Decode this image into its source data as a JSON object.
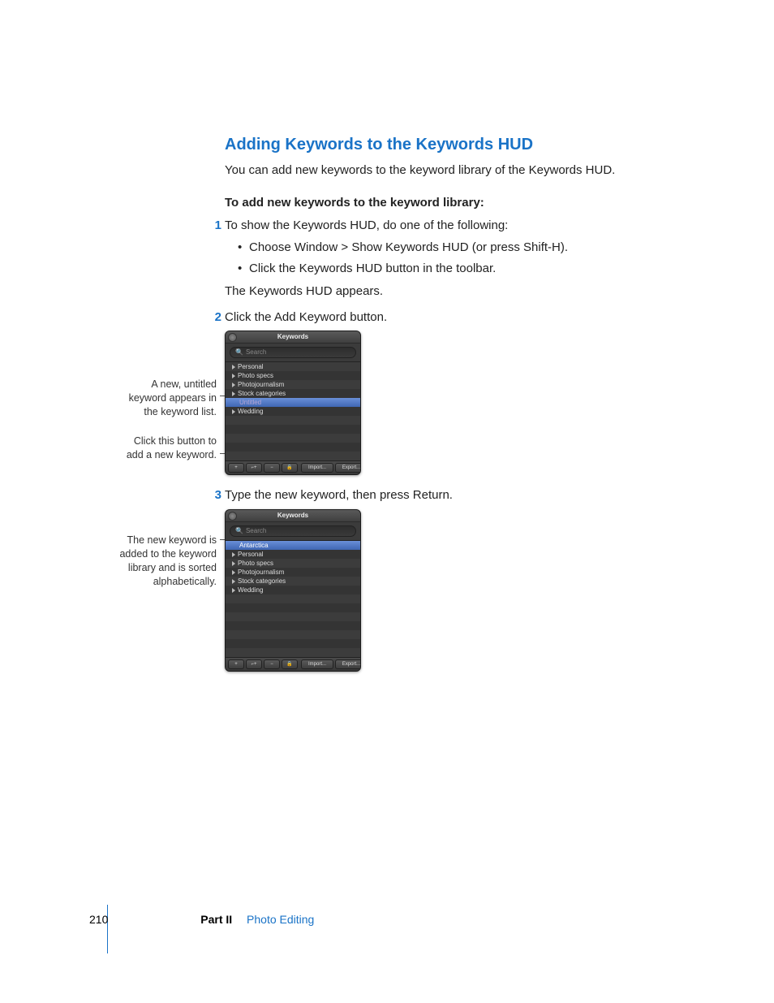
{
  "heading": "Adding Keywords to the Keywords HUD",
  "intro": "You can add new keywords to the keyword library of the Keywords HUD.",
  "task_heading": "To add new keywords to the keyword library:",
  "steps": {
    "n1": "1",
    "s1": "To show the Keywords HUD, do one of the following:",
    "b1a": "Choose Window > Show Keywords HUD (or press Shift-H).",
    "b1b": "Click the Keywords HUD button in the toolbar.",
    "s1_after": "The Keywords HUD appears.",
    "n2": "2",
    "s2": "Click the Add Keyword button.",
    "n3": "3",
    "s3": "Type the new keyword, then press Return."
  },
  "callouts": {
    "c1_l1": "A new, untitled",
    "c1_l2": "keyword appears in",
    "c1_l3": "the keyword list.",
    "c2_l1": "Click this button to",
    "c2_l2": "add a new keyword.",
    "c3_l1": "The new keyword is",
    "c3_l2": "added to the keyword",
    "c3_l3": "library and is sorted",
    "c3_l4": "alphabetically."
  },
  "hud": {
    "title": "Keywords",
    "search_placeholder": "Search",
    "rows1": {
      "r0": "Personal",
      "r1": "Photo specs",
      "r2": "Photojournalism",
      "r3": "Stock categories",
      "r4": "Untitled",
      "r5": "Wedding"
    },
    "rows2": {
      "r0": "Antarctica",
      "r1": "Personal",
      "r2": "Photo specs",
      "r3": "Photojournalism",
      "r4": "Stock categories",
      "r5": "Wedding"
    },
    "footer": {
      "import": "Import...",
      "export": "Export..."
    }
  },
  "footer": {
    "page_number": "210",
    "part_label": "Part II",
    "chapter_label": "Photo Editing"
  }
}
